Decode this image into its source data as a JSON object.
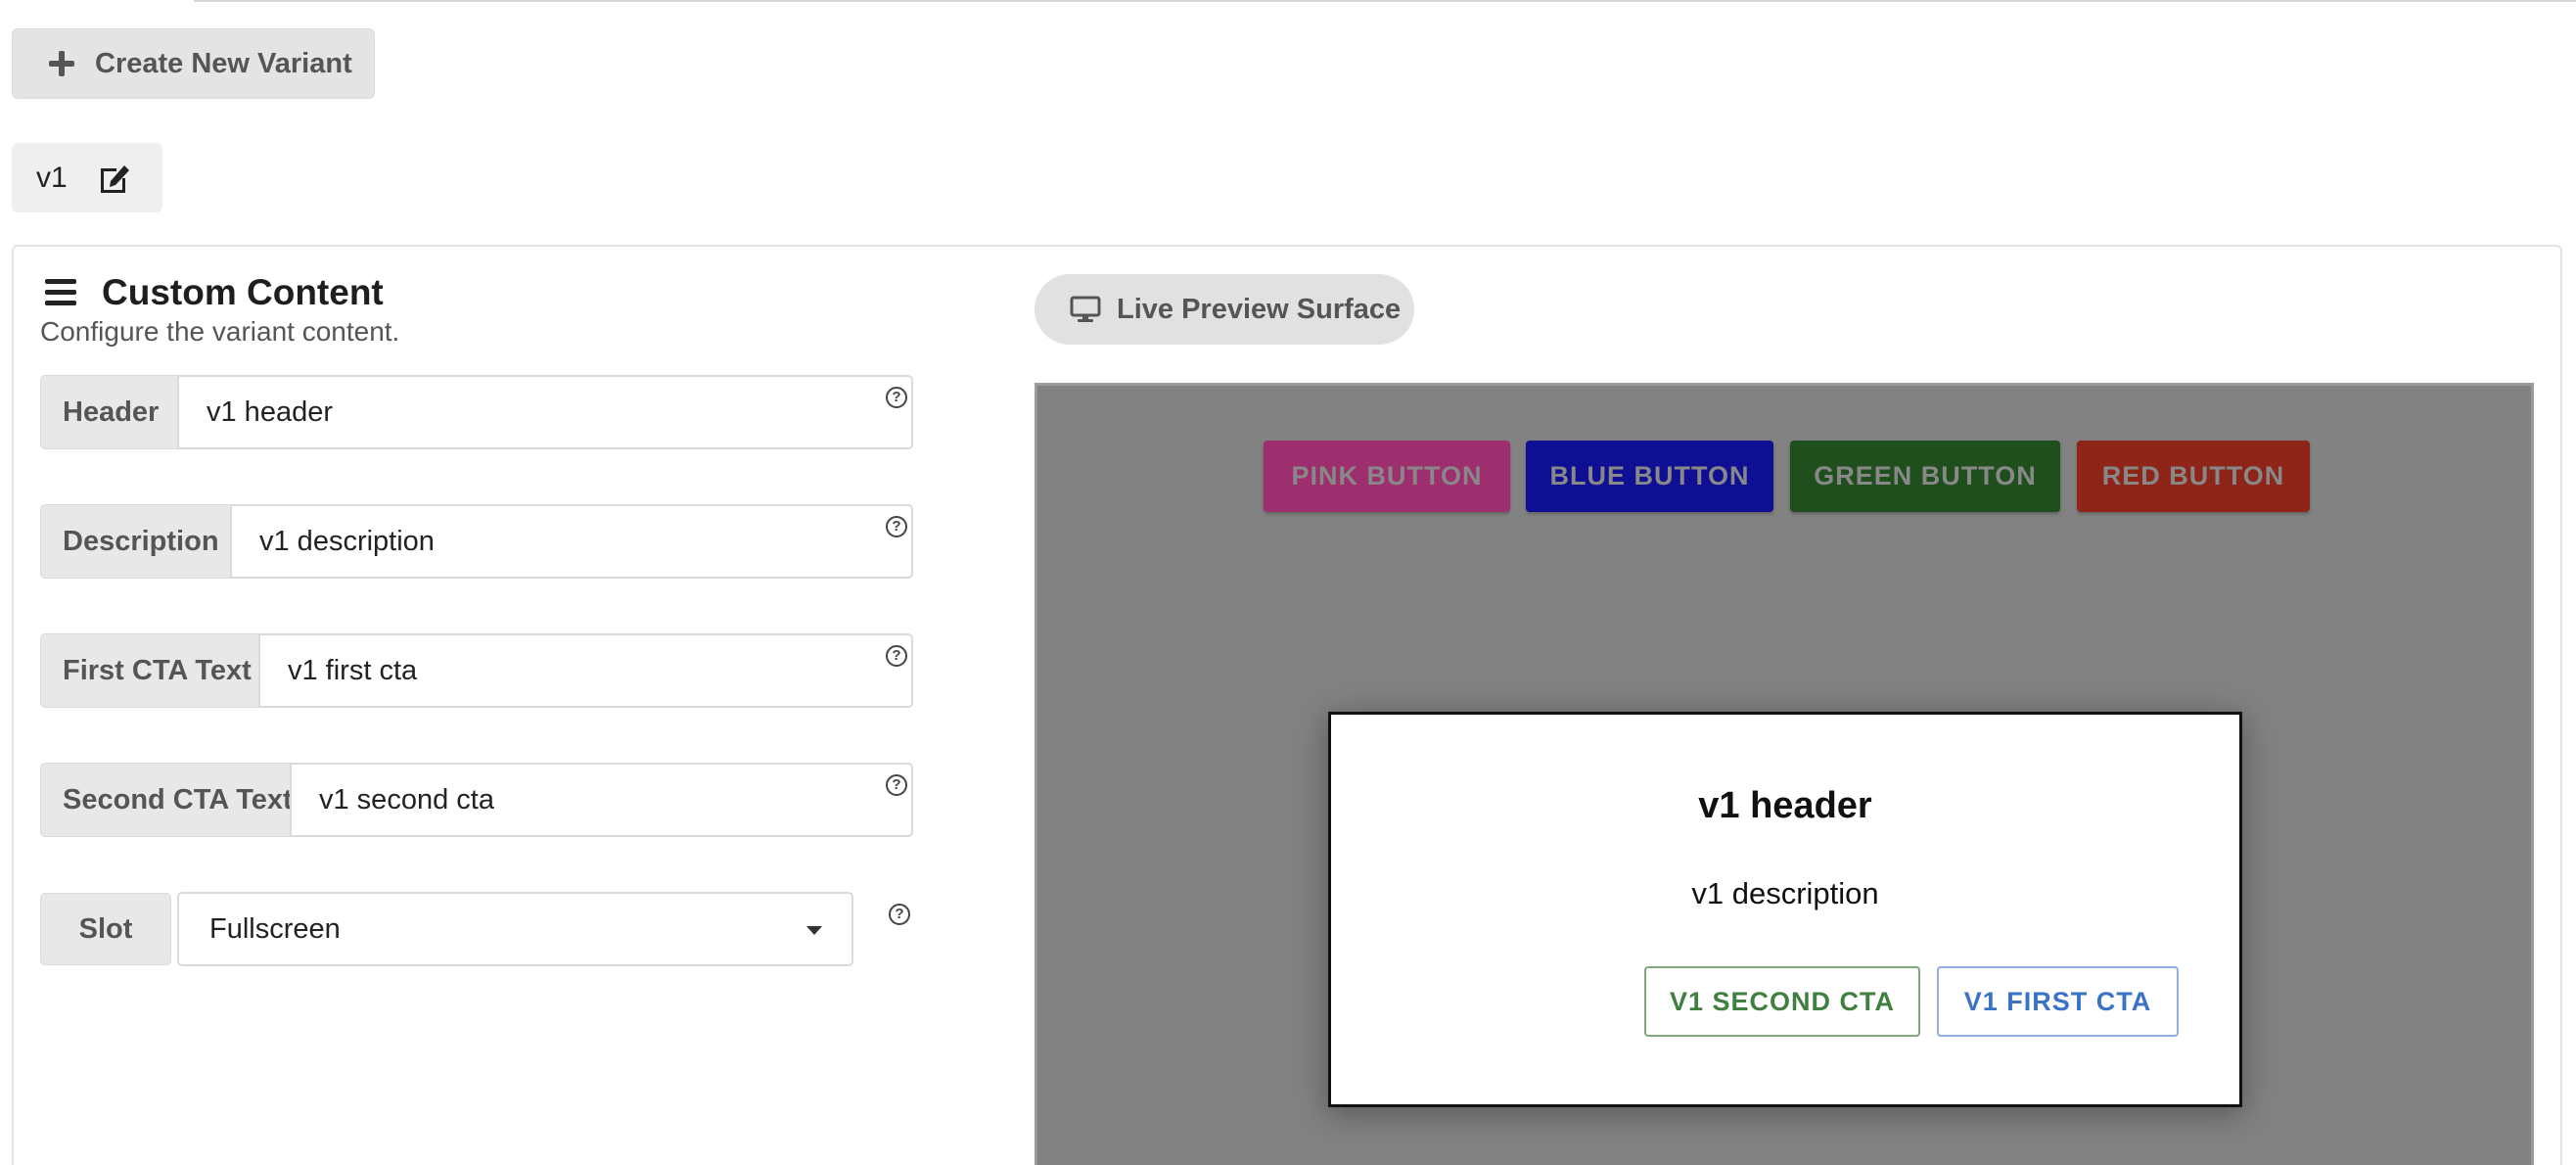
{
  "toolbar": {
    "create_variant_label": "Create New Variant"
  },
  "variants": {
    "active_tab_label": "v1"
  },
  "panel": {
    "title": "Custom Content",
    "subtitle": "Configure the variant content."
  },
  "form": {
    "fields": [
      {
        "label": "Header",
        "value": "v1 header"
      },
      {
        "label": "Description",
        "value": "v1 description"
      },
      {
        "label": "First CTA Text",
        "value": "v1 first cta"
      },
      {
        "label": "Second CTA Text",
        "value": "v1 second cta"
      }
    ],
    "slot": {
      "label": "Slot",
      "selected": "Fullscreen"
    },
    "help_glyph": "?"
  },
  "preview": {
    "pill_label": "Live Preview Surface",
    "buttons": [
      {
        "label": "PINK BUTTON",
        "color": "#9e2f6e"
      },
      {
        "label": "BLUE BUTTON",
        "color": "#0e0f92"
      },
      {
        "label": "GREEN BUTTON",
        "color": "#1e4f1c"
      },
      {
        "label": "RED BUTTON",
        "color": "#8f2519"
      }
    ],
    "modal": {
      "header": "v1 header",
      "description": "v1 description",
      "second_cta": "V1 SECOND CTA",
      "first_cta": "V1 FIRST CTA"
    }
  }
}
